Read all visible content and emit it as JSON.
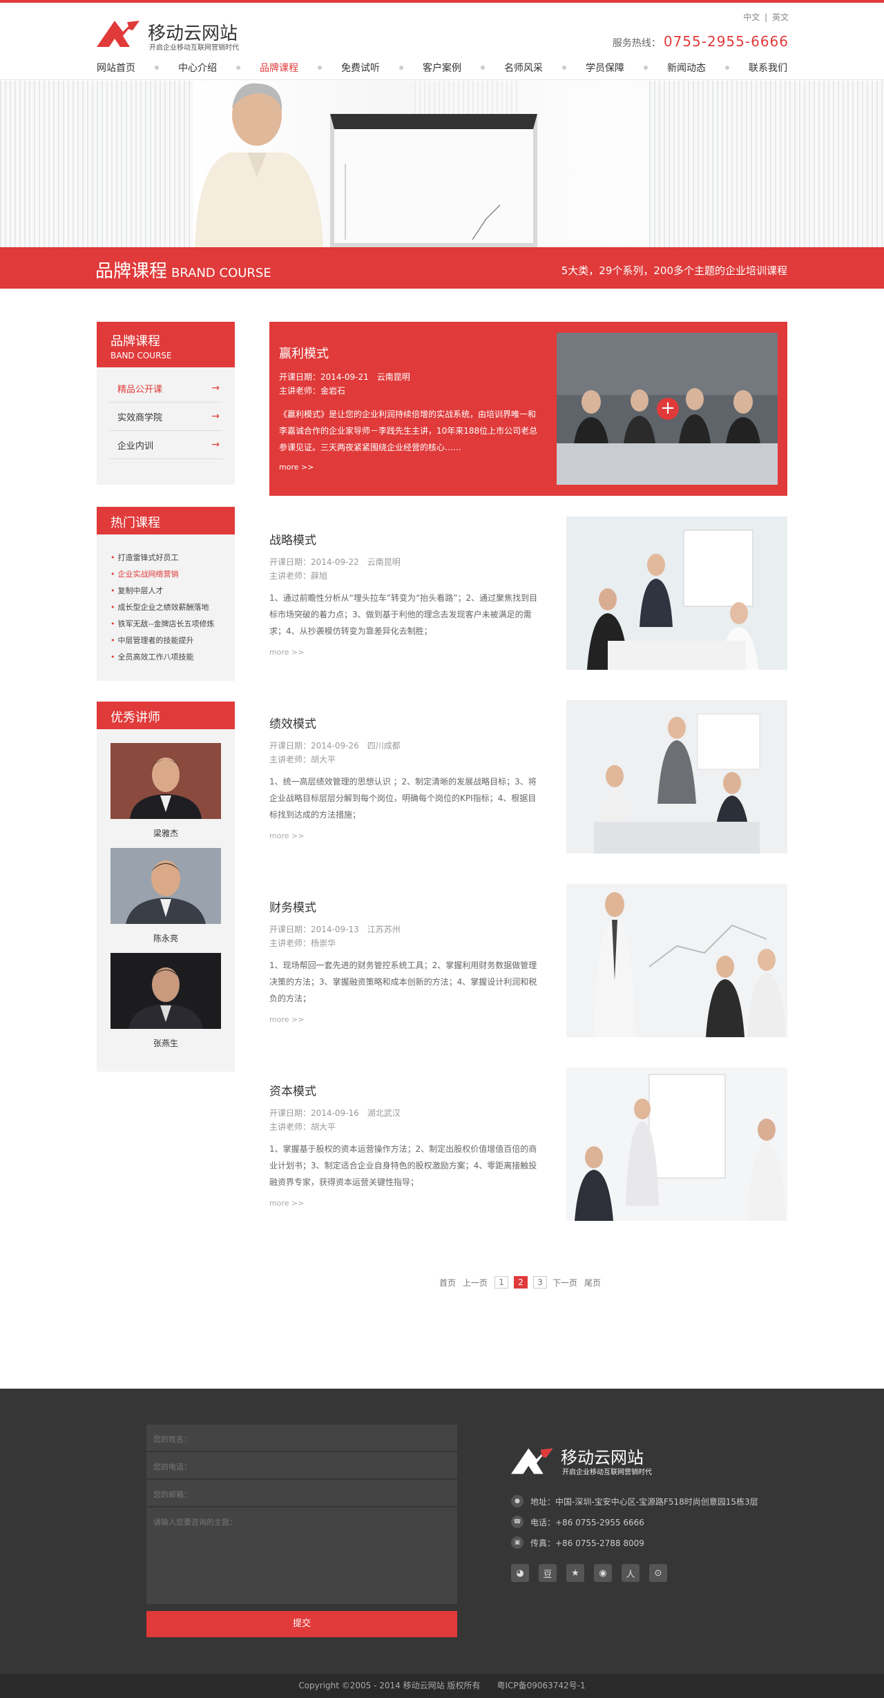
{
  "header": {
    "logo_name": "移动云网站",
    "logo_slogan": "开启企业移动互联网营销时代",
    "lang_cn": "中文",
    "lang_sep": "|",
    "lang_en": "英文",
    "hotline_label": "服务热线：",
    "hotline_number": "0755-2955-6666"
  },
  "nav": [
    {
      "label": "网站首页"
    },
    {
      "label": "中心介绍"
    },
    {
      "label": "品牌课程"
    },
    {
      "label": "免费试听"
    },
    {
      "label": "客户案例"
    },
    {
      "label": "名师风采"
    },
    {
      "label": "学员保障"
    },
    {
      "label": "新闻动态"
    },
    {
      "label": "联系我们"
    }
  ],
  "banner": {
    "title_cn": "品牌课程",
    "title_en": "BRAND COURSE",
    "subtitle": "5大类，29个系列，200多个主题的企业培训课程"
  },
  "sidebar": {
    "brand_title": "品牌课程",
    "brand_title_en": "BAND COURSE",
    "menu": [
      {
        "label": "精品公开课",
        "arrow": "→"
      },
      {
        "label": "实效商学院",
        "arrow": "→"
      },
      {
        "label": "企业内训",
        "arrow": "→"
      }
    ],
    "hot_title": "热门课程",
    "hot": [
      "打造雷锋式好员工",
      "企业实战网络营销",
      "复制中层人才",
      "成长型企业之绩效薪酬落地",
      "铁军无敌--金牌店长五项修炼",
      "中层管理者的技能提升",
      "全员高效工作八项技能"
    ],
    "teacher_title": "优秀讲师",
    "teachers": [
      {
        "name": "梁雅杰"
      },
      {
        "name": "陈永亮"
      },
      {
        "name": "张燕生"
      }
    ]
  },
  "feature": {
    "title": "赢利模式",
    "date": "开课日期：2014-09-21　云南昆明",
    "teacher": "主讲老师：金岩石",
    "desc": "《赢利模式》是让您的企业利润持续倍增的实战系统，由培训界唯一和李嘉诚合作的企业家导师－李践先生主讲，10年来188位上市公司老总参课见证。三天两夜紧紧围绕企业经营的核心……",
    "more": "more >>",
    "plus": "+"
  },
  "courses": [
    {
      "title": "战略模式",
      "date": "开课日期：2014-09-22　云南昆明",
      "teacher": "主讲老师：薛旭",
      "desc": "1、通过前瞻性分析从“埋头拉车”转变为“抬头看路”；2、通过聚焦找到目标市场突破的着力点；3、做到基于利他的理念去发现客户未被满足的需求；4、从抄袭模仿转变为靠差异化去制胜；",
      "more": "more >>"
    },
    {
      "title": "绩效模式",
      "date": "开课日期：2014-09-26　四川成都",
      "teacher": "主讲老师：胡大平",
      "desc": "1、统一高层绩效管理的思想认识 ；2、制定清晰的发展战略目标；3、将企业战略目标层层分解到每个岗位，明确每个岗位的KPI指标；4、根据目标找到达成的方法措施；",
      "more": "more >>"
    },
    {
      "title": "财务模式",
      "date": "开课日期：2014-09-13　江苏苏州",
      "teacher": "主讲老师：杨崇华",
      "desc": "1、现场帮回一套先进的财务管控系统工具；2、掌握利用财务数据做管理决策的方法；3、掌握融资策略和成本创新的方法；4、掌握设计利润和税负的方法；",
      "more": "more >>"
    },
    {
      "title": "资本模式",
      "date": "开课日期：2014-09-16　湖北武汉",
      "teacher": "主讲老师：胡大平",
      "desc": "1、掌握基于股权的资本运营操作方法；2、制定出股权价值增值百倍的商业计划书；3、制定适合企业自身特色的股权激励方案；4、零距离接触投融资界专家，获得资本运营关键性指导；",
      "more": "more >>"
    }
  ],
  "pager": {
    "first": "首页",
    "prev": "上一页",
    "pages": [
      "1",
      "2",
      "3"
    ],
    "next": "下一页",
    "last": "尾页"
  },
  "footer": {
    "name_ph": "您的姓名：",
    "phone_ph": "您的电话：",
    "email_ph": "您的邮箱：",
    "topic_ph": "请输入您要咨询的主题：",
    "submit": "提交",
    "logo_name": "移动云网站",
    "logo_slogan": "开启企业移动互联网营销时代",
    "address": "地址：中国-深圳-宝安中心区-宝源路F518时尚创意园15栋3层",
    "phone": "电话：+86 0755-2955 6666",
    "fax": "传真：+86 0755-2788 8009",
    "copyright": "Copyright ©2005 - 2014  移动云网站 版权所有　　粤ICP备09063742号-1"
  },
  "colors": {
    "accent": "#e03a3a",
    "footer_bg": "#363636"
  }
}
